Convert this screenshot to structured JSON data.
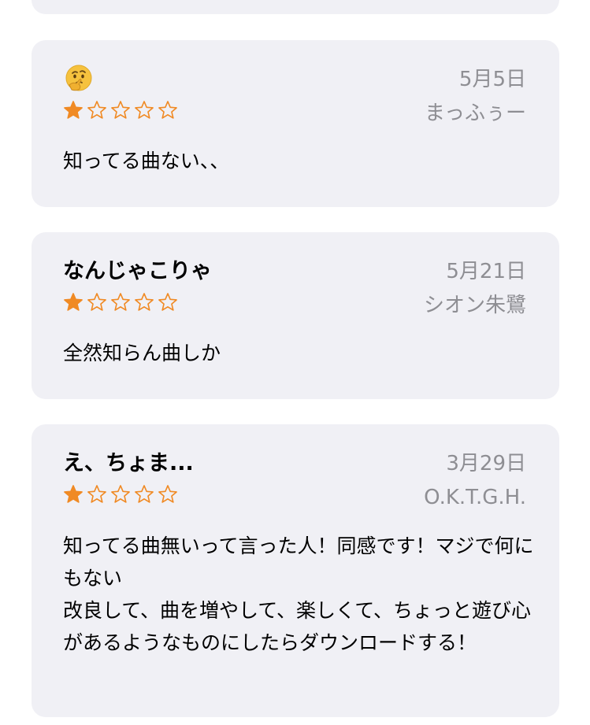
{
  "colors": {
    "card_background": "#f0f0f5",
    "star_filled": "#f08a24",
    "meta_text": "#8e8e93"
  },
  "reviews": [
    {
      "title": "",
      "title_icon": "thinking-face-emoji",
      "date": "5月5日",
      "author": "まっふぅー",
      "rating": 1,
      "max_rating": 5,
      "body": "知ってる曲ない、、"
    },
    {
      "title": "なんじゃこりゃ",
      "date": "5月21日",
      "author": "シオン朱鷺",
      "rating": 1,
      "max_rating": 5,
      "body": "全然知らん曲しか"
    },
    {
      "title": "え、ちょま...",
      "date": "3月29日",
      "author": "O.K.T.G.H.",
      "rating": 1,
      "max_rating": 5,
      "body": "知ってる曲無いって言った人！同感です！マジで何にもない\n改良して、曲を増やして、楽しくて、ちょっと遊び心があるようなものにしたらダウンロードする！"
    }
  ]
}
